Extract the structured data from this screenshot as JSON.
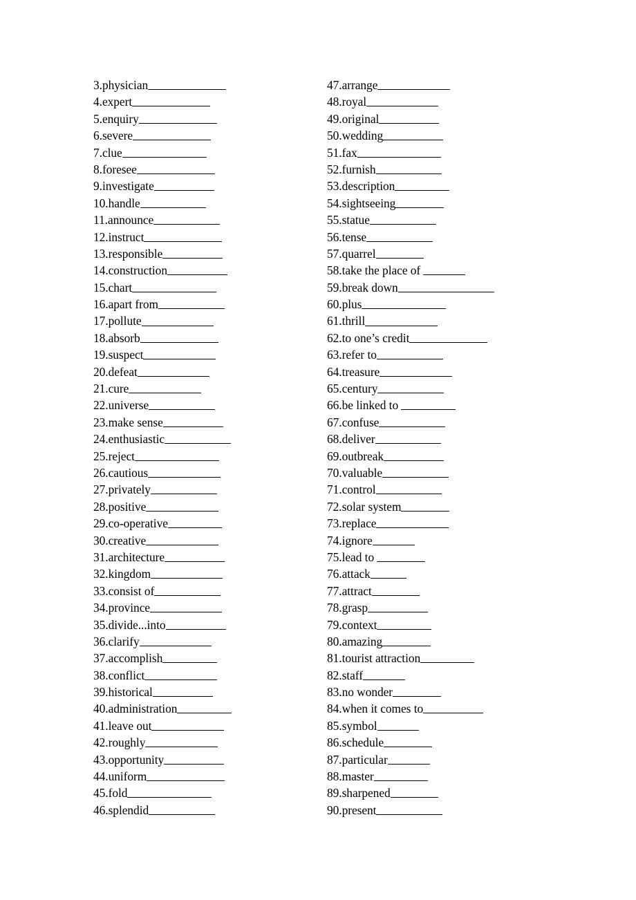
{
  "document": {
    "type": "vocabulary-worksheet",
    "columns": [
      {
        "name": "left-column",
        "entries": [
          {
            "number": "3.",
            "term": "physician",
            "blank_len": 13
          },
          {
            "number": "4.",
            "term": "expert",
            "blank_len": 13
          },
          {
            "number": "5.",
            "term": "enquiry",
            "blank_len": 13
          },
          {
            "number": "6.",
            "term": "severe",
            "blank_len": 13
          },
          {
            "number": "7.",
            "term": "clue",
            "blank_len": 14
          },
          {
            "number": "8.",
            "term": "foresee",
            "blank_len": 13
          },
          {
            "number": "9.",
            "term": "investigate",
            "blank_len": 10
          },
          {
            "number": "10.",
            "term": "handle",
            "blank_len": 11
          },
          {
            "number": "11.",
            "term": "announce",
            "blank_len": 11
          },
          {
            "number": "12.",
            "term": "instruct",
            "blank_len": 13
          },
          {
            "number": "13.",
            "term": "responsible",
            "blank_len": 10
          },
          {
            "number": "14.",
            "term": "construction",
            "blank_len": 10
          },
          {
            "number": "15.",
            "term": "chart",
            "blank_len": 14
          },
          {
            "number": "16.",
            "term": "apart from",
            "blank_len": 11
          },
          {
            "number": "17.",
            "term": "pollute",
            "blank_len": 12
          },
          {
            "number": "18.",
            "term": "absorb",
            "blank_len": 13
          },
          {
            "number": "19.",
            "term": "suspect",
            "blank_len": 12
          },
          {
            "number": "20.",
            "term": "defeat",
            "blank_len": 12
          },
          {
            "number": "21.",
            "term": "cure",
            "blank_len": 12
          },
          {
            "number": "22.",
            "term": "universe",
            "blank_len": 11
          },
          {
            "number": "23.",
            "term": "make sense",
            "blank_len": 10
          },
          {
            "number": "24.",
            "term": "enthusiastic",
            "blank_len": 11
          },
          {
            "number": "25.",
            "term": "reject",
            "blank_len": 14
          },
          {
            "number": "26.",
            "term": "cautious",
            "blank_len": 12
          },
          {
            "number": "27.",
            "term": "privately",
            "blank_len": 11
          },
          {
            "number": "28.",
            "term": "positive",
            "blank_len": 12
          },
          {
            "number": "29.",
            "term": "co-operative",
            "blank_len": 9
          },
          {
            "number": "30.",
            "term": "creative",
            "blank_len": 12
          },
          {
            "number": "31.",
            "term": "architecture",
            "blank_len": 10
          },
          {
            "number": "32.",
            "term": "kingdom",
            "blank_len": 12
          },
          {
            "number": "33.",
            "term": "consist of",
            "blank_len": 11
          },
          {
            "number": "34.",
            "term": "province",
            "blank_len": 12
          },
          {
            "number": "35.",
            "term": "divide...into",
            "blank_len": 10
          },
          {
            "number": "36.",
            "term": "clarify",
            "blank_len": 12
          },
          {
            "number": "37.",
            "term": "accomplish",
            "blank_len": 9
          },
          {
            "number": "38.",
            "term": "conflict",
            "blank_len": 12
          },
          {
            "number": "39.",
            "term": "historical",
            "blank_len": 10
          },
          {
            "number": "40.",
            "term": "administration",
            "blank_len": 9
          },
          {
            "number": "41.",
            "term": "leave out",
            "blank_len": 12
          },
          {
            "number": "42.",
            "term": "roughly",
            "blank_len": 12
          },
          {
            "number": "43.",
            "term": "opportunity",
            "blank_len": 10
          },
          {
            "number": "44.",
            "term": "uniform",
            "blank_len": 13
          },
          {
            "number": "45.",
            "term": "fold",
            "blank_len": 14
          },
          {
            "number": "46.",
            "term": "splendid",
            "blank_len": 11
          }
        ]
      },
      {
        "name": "right-column",
        "entries": [
          {
            "number": "47.",
            "term": "arrange",
            "blank_len": 12
          },
          {
            "number": "48.",
            "term": "royal",
            "blank_len": 12
          },
          {
            "number": "49.",
            "term": "original",
            "blank_len": 10
          },
          {
            "number": "50.",
            "term": "wedding",
            "blank_len": 10
          },
          {
            "number": "51.",
            "term": "fax",
            "blank_len": 14
          },
          {
            "number": "52.",
            "term": "furnish",
            "blank_len": 11
          },
          {
            "number": "53.",
            "term": "description",
            "blank_len": 9
          },
          {
            "number": "54.",
            "term": "sightseeing",
            "blank_len": 8
          },
          {
            "number": "55.",
            "term": "statue",
            "blank_len": 11
          },
          {
            "number": "56.",
            "term": "tense",
            "blank_len": 11
          },
          {
            "number": "57.",
            "term": "quarrel",
            "blank_len": 8
          },
          {
            "number": "58.",
            "term": "take the place of ",
            "blank_len": 7
          },
          {
            "number": "59.",
            "term": "break down",
            "blank_len": 16
          },
          {
            "number": "60.",
            "term": "plus",
            "blank_len": 14
          },
          {
            "number": "61.",
            "term": "thrill",
            "blank_len": 12
          },
          {
            "number": "62.",
            "term": "to one’s credit",
            "blank_len": 13
          },
          {
            "number": "63.",
            "term": "refer to",
            "blank_len": 11
          },
          {
            "number": "64.",
            "term": "treasure",
            "blank_len": 12
          },
          {
            "number": "65.",
            "term": "century",
            "blank_len": 11
          },
          {
            "number": "66.",
            "term": "be linked to ",
            "blank_len": 9
          },
          {
            "number": "67.",
            "term": "confuse",
            "blank_len": 11
          },
          {
            "number": "68.",
            "term": "deliver",
            "blank_len": 11
          },
          {
            "number": "69.",
            "term": "outbreak",
            "blank_len": 10
          },
          {
            "number": "70.",
            "term": "valuable",
            "blank_len": 11
          },
          {
            "number": "71.",
            "term": "control",
            "blank_len": 11
          },
          {
            "number": "72.",
            "term": "solar system",
            "blank_len": 8
          },
          {
            "number": "73.",
            "term": "replace",
            "blank_len": 12
          },
          {
            "number": "74.",
            "term": "ignore",
            "blank_len": 7
          },
          {
            "number": "75.",
            "term": "lead to ",
            "blank_len": 8
          },
          {
            "number": "76.",
            "term": "attack",
            "blank_len": 6
          },
          {
            "number": "77.",
            "term": "attract",
            "blank_len": 8
          },
          {
            "number": "78.",
            "term": "grasp",
            "blank_len": 10
          },
          {
            "number": "79.",
            "term": "context",
            "blank_len": 9
          },
          {
            "number": "80.",
            "term": "amazing",
            "blank_len": 8
          },
          {
            "number": "81.",
            "term": "tourist attraction",
            "blank_len": 9
          },
          {
            "number": "82.",
            "term": "staff",
            "blank_len": 7
          },
          {
            "number": "83.",
            "term": "no wonder",
            "blank_len": 8
          },
          {
            "number": "84.",
            "term": "when it comes to",
            "blank_len": 10
          },
          {
            "number": "85.",
            "term": "symbol",
            "blank_len": 7
          },
          {
            "number": "86.",
            "term": "schedule",
            "blank_len": 8
          },
          {
            "number": "87.",
            "term": "particular",
            "blank_len": 7
          },
          {
            "number": "88.",
            "term": "master",
            "blank_len": 9
          },
          {
            "number": "89.",
            "term": "sharpened",
            "blank_len": 8
          },
          {
            "number": "90.",
            "term": "present",
            "blank_len": 11
          }
        ]
      }
    ]
  }
}
